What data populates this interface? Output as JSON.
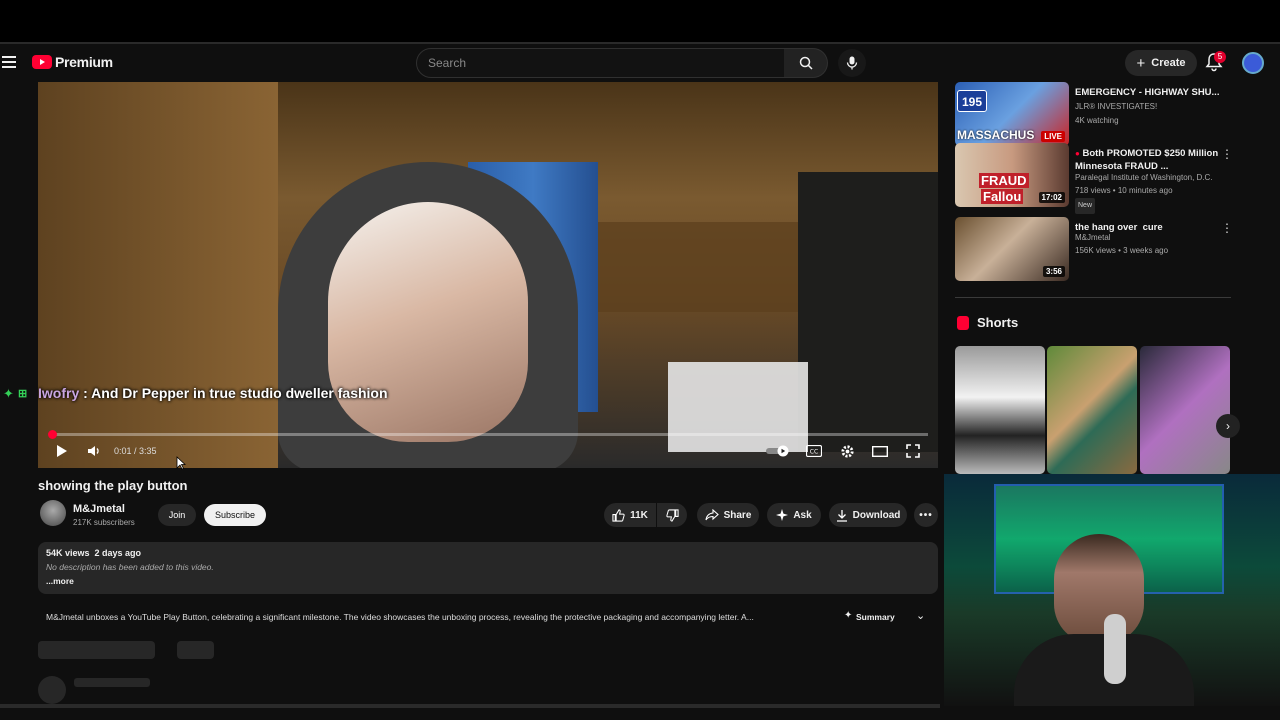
{
  "masthead": {
    "logo_text": "Premium",
    "search_placeholder": "Search",
    "create_label": "Create",
    "notification_count": "5"
  },
  "player": {
    "caption_user": "Iwofry",
    "caption_text": ": And Dr Pepper in true studio dweller fashion",
    "time": "0:01 / 3:35",
    "progress": 0.005
  },
  "video": {
    "title": "showing the play button",
    "channel_name": "M&Jmetal",
    "subscribers": "217K subscribers",
    "join_label": "Join",
    "subscribe_label": "Subscribe",
    "likes": "11K",
    "share_label": "Share",
    "ask_label": "Ask",
    "download_label": "Download",
    "views_date": "54K views  2 days ago",
    "description": "No description has been added to this video.",
    "more_label": "...more",
    "ai_summary": "M&Jmetal unboxes a YouTube Play Button, celebrating a significant milestone. The video showcases the unboxing process, revealing the protective packaging and accompanying letter. A...",
    "summary_label": "Summary"
  },
  "recommendations": [
    {
      "title": "EMERGENCY - HIGHWAY SHU...",
      "channel": "JLR® INVESTIGATES!",
      "meta": "4K watching",
      "badge": "LIVE",
      "thumb_text": "MASSACHUS",
      "thumb_sign": "195"
    },
    {
      "title": "Both PROMOTED $250 Million Minnesota FRAUD ...",
      "channel": "Paralegal Institute of Washington, D.C.",
      "meta": "718 views • 10 minutes ago",
      "tag": "New",
      "duration": "17:02",
      "thumb_text": "FRAUD",
      "thumb_text2": "Fallou"
    },
    {
      "title": "the hang over  cure",
      "channel": "M&Jmetal",
      "meta": "156K views • 3 weeks ago",
      "duration": "3:56"
    }
  ],
  "shorts": {
    "title": "Shorts"
  },
  "colors": {
    "brand_red": "#ff0033",
    "background": "#0f0f0f",
    "chip": "#272727"
  }
}
